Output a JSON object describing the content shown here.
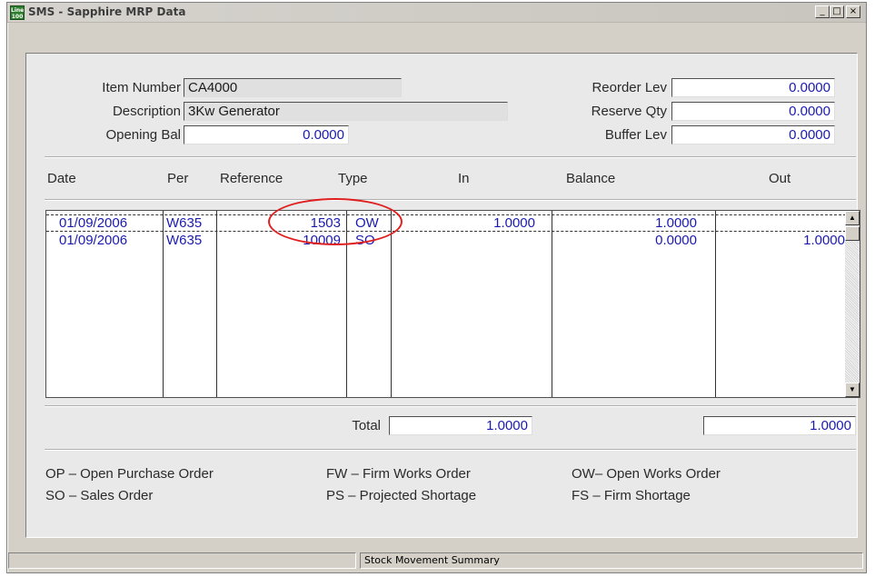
{
  "window": {
    "title": "SMS - Sapphire MRP Data",
    "icon_text_top": "Line",
    "icon_text_bottom": "100",
    "buttons": [
      "minimize-icon",
      "maximize-icon",
      "close-icon"
    ]
  },
  "header": {
    "item_number_label": "Item Number",
    "item_number_value": "CA4000",
    "description_label": "Description",
    "description_value": "3Kw Generator",
    "opening_bal_label": "Opening Bal",
    "opening_bal_value": "0.0000",
    "reorder_lev_label": "Reorder Lev",
    "reorder_lev_value": "0.0000",
    "reserve_qty_label": "Reserve Qty",
    "reserve_qty_value": "0.0000",
    "buffer_lev_label": "Buffer Lev",
    "buffer_lev_value": "0.0000"
  },
  "table": {
    "columns": [
      "Date",
      "Per",
      "Reference",
      "Type",
      "In",
      "Balance",
      "Out"
    ],
    "rows": [
      {
        "date": "01/09/2006",
        "per": "W635",
        "reference": "1503",
        "type": "OW",
        "in": "1.0000",
        "balance": "1.0000",
        "out": ""
      },
      {
        "date": "01/09/2006",
        "per": "W635",
        "reference": "10009",
        "type": "SO",
        "in": "",
        "balance": "0.0000",
        "out": "1.0000"
      }
    ]
  },
  "totals": {
    "label": "Total",
    "in_total": "1.0000",
    "out_total": "1.0000"
  },
  "legend": {
    "op": "OP – Open Purchase Order",
    "so": "SO – Sales Order",
    "fw": "FW – Firm Works Order",
    "ps": "PS – Projected Shortage",
    "ow": "OW– Open Works Order",
    "fs": "FS – Firm Shortage"
  },
  "status": {
    "panel1": "",
    "panel2": "",
    "panel3": "Stock Movement Summary"
  },
  "colors": {
    "value_text": "#1a1ab0",
    "annotation": "#e02020",
    "panel_bg": "#e9e9e9",
    "window_bg": "#d4d0c8"
  }
}
